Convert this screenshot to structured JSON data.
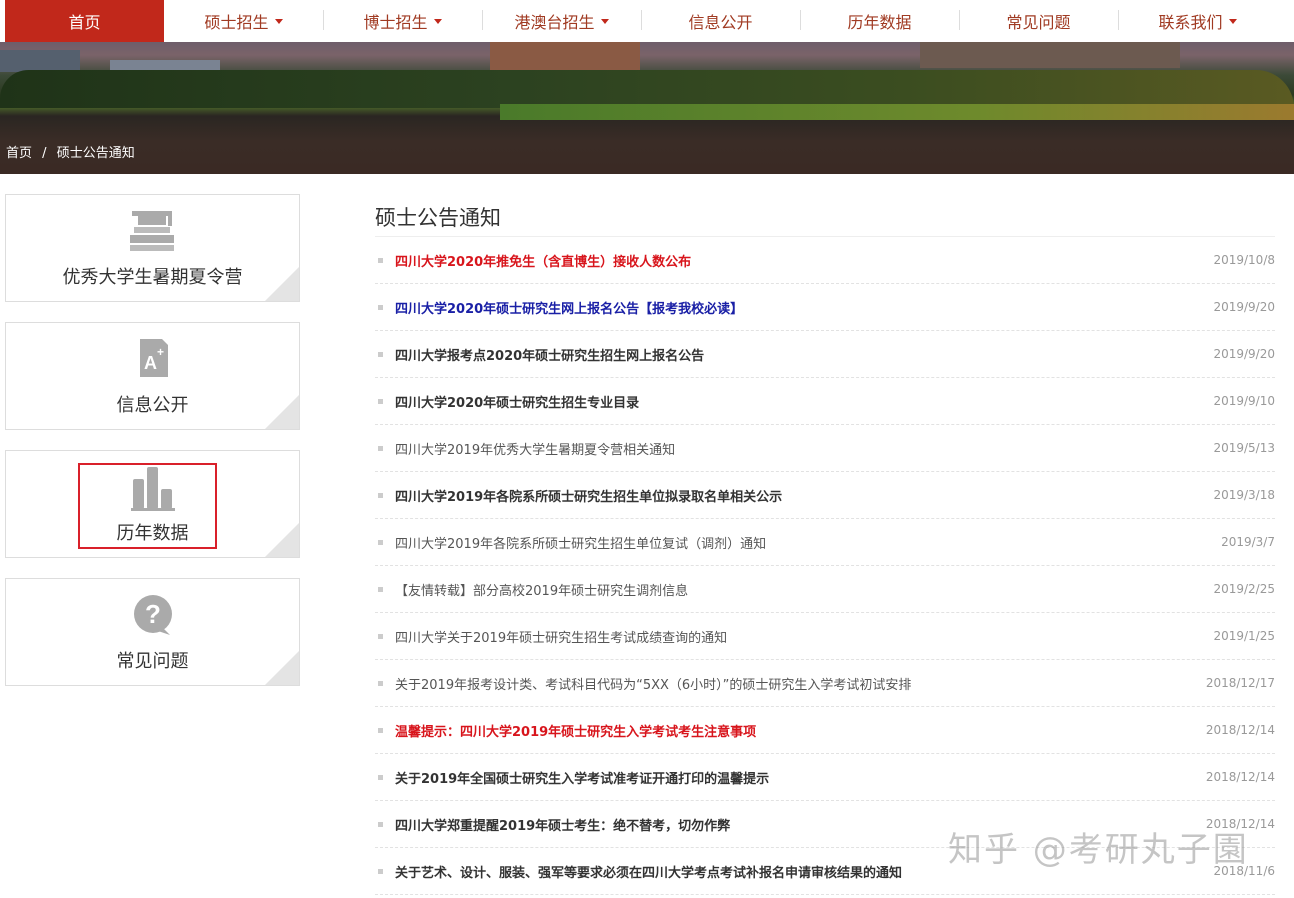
{
  "nav": [
    {
      "label": "首页",
      "dropdown": false
    },
    {
      "label": "硕士招生",
      "dropdown": true
    },
    {
      "label": "博士招生",
      "dropdown": true
    },
    {
      "label": "港澳台招生",
      "dropdown": true
    },
    {
      "label": "信息公开",
      "dropdown": false
    },
    {
      "label": "历年数据",
      "dropdown": false
    },
    {
      "label": "常见问题",
      "dropdown": false
    },
    {
      "label": "联系我们",
      "dropdown": true
    }
  ],
  "breadcrumb": {
    "home": "首页",
    "sep": "/",
    "current": "硕士公告通知"
  },
  "sidebar": [
    {
      "label": "优秀大学生暑期夏令营",
      "icon": "graduation-cap-books-icon"
    },
    {
      "label": "信息公开",
      "icon": "document-a-plus-icon"
    },
    {
      "label": "历年数据",
      "icon": "bar-chart-icon",
      "highlighted": true
    },
    {
      "label": "常见问题",
      "icon": "question-bubble-icon"
    }
  ],
  "main": {
    "title": "硕士公告通知",
    "items": [
      {
        "title": "四川大学2020年推免生（含直博生）接收人数公布",
        "date": "2019/10/8",
        "style": "red"
      },
      {
        "title": "四川大学2020年硕士研究生网上报名公告【报考我校必读】",
        "date": "2019/9/20",
        "style": "blue"
      },
      {
        "title": "四川大学报考点2020年硕士研究生招生网上报名公告",
        "date": "2019/9/20",
        "style": "bold"
      },
      {
        "title": "四川大学2020年硕士研究生招生专业目录",
        "date": "2019/9/10",
        "style": "bold"
      },
      {
        "title": "四川大学2019年优秀大学生暑期夏令营相关通知",
        "date": "2019/5/13",
        "style": "normal"
      },
      {
        "title": "四川大学2019年各院系所硕士研究生招生单位拟录取名单相关公示",
        "date": "2019/3/18",
        "style": "bold"
      },
      {
        "title": "四川大学2019年各院系所硕士研究生招生单位复试（调剂）通知",
        "date": "2019/3/7",
        "style": "normal"
      },
      {
        "title": "【友情转载】部分高校2019年硕士研究生调剂信息",
        "date": "2019/2/25",
        "style": "normal"
      },
      {
        "title": "四川大学关于2019年硕士研究生招生考试成绩查询的通知",
        "date": "2019/1/25",
        "style": "normal"
      },
      {
        "title": "关于2019年报考设计类、考试科目代码为“5XX（6小时）”的硕士研究生入学考试初试安排",
        "date": "2018/12/17",
        "style": "normal"
      },
      {
        "title": "温馨提示：四川大学2019年硕士研究生入学考试考生注意事项",
        "date": "2018/12/14",
        "style": "red"
      },
      {
        "title": "关于2019年全国硕士研究生入学考试准考证开通打印的温馨提示",
        "date": "2018/12/14",
        "style": "bold"
      },
      {
        "title": "四川大学郑重提醒2019年硕士考生：绝不替考，切勿作弊",
        "date": "2018/12/14",
        "style": "bold"
      },
      {
        "title": "关于艺术、设计、服装、强军等要求必须在四川大学考点考试补报名申请审核结果的通知",
        "date": "2018/11/6",
        "style": "bold"
      }
    ]
  },
  "watermark": "知乎 @考研丸子園"
}
